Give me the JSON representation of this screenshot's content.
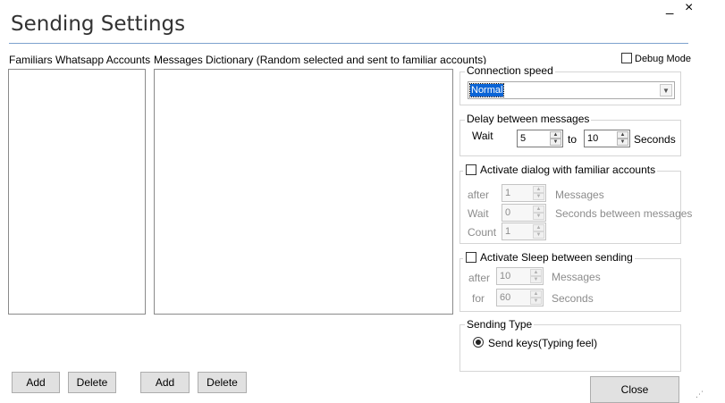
{
  "window": {
    "title": "Sending Settings",
    "minimize_glyph": "_",
    "close_glyph": "×"
  },
  "debug_mode": {
    "label": "Debug Mode",
    "checked": false
  },
  "accounts": {
    "header": "Familiars Whatsapp Accounts",
    "add_label": "Add",
    "delete_label": "Delete"
  },
  "messages": {
    "header": "Messages Dictionary  (Random selected and sent to familiar accounts)",
    "add_label": "Add",
    "delete_label": "Delete"
  },
  "connection_speed": {
    "title": "Connection speed",
    "selected": "Normal"
  },
  "delay": {
    "title": "Delay between messages",
    "wait_label": "Wait",
    "from_value": "5",
    "to_label": "to",
    "to_value": "10",
    "unit_label": "Seconds"
  },
  "dialog": {
    "title": "Activate dialog with familiar accounts",
    "checked": false,
    "after_label": "after",
    "after_value": "1",
    "after_unit": "Messages",
    "wait_label": "Wait",
    "wait_value": "0",
    "wait_unit": "Seconds between messages",
    "count_label": "Count",
    "count_value": "1"
  },
  "sleep": {
    "title": "Activate Sleep between sending",
    "checked": false,
    "after_label": "after",
    "after_value": "10",
    "after_unit": "Messages",
    "for_label": "for",
    "for_value": "60",
    "for_unit": "Seconds"
  },
  "sending_type": {
    "title": "Sending Type",
    "option_label": "Send keys(Typing feel)",
    "selected": true
  },
  "close_button": {
    "label": "Close"
  }
}
